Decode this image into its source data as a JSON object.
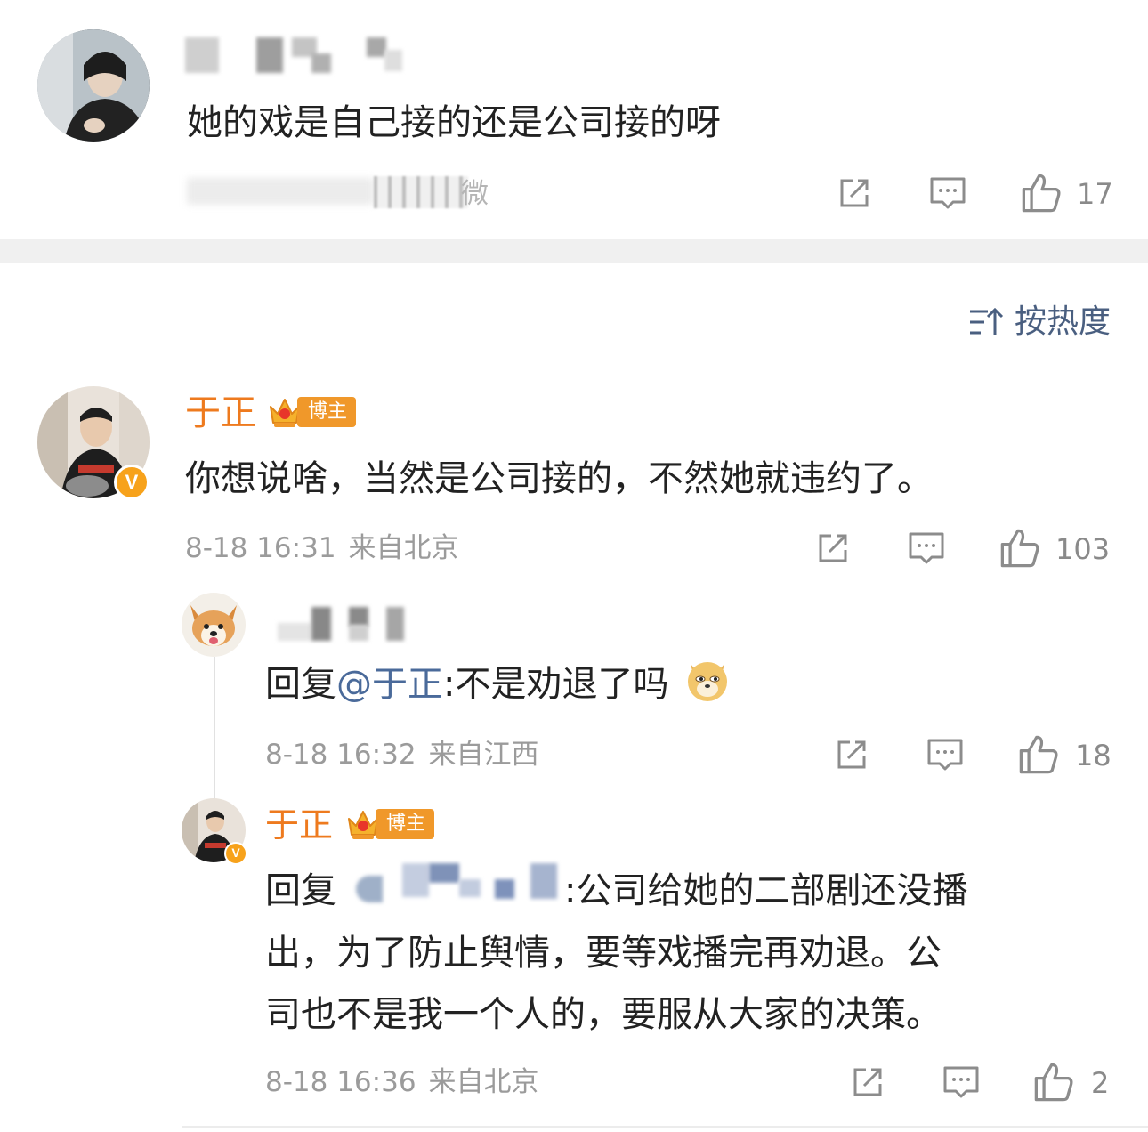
{
  "top_comment": {
    "text": "她的戏是自己接的还是公司接的呀",
    "meta_tail": "微",
    "likes": "17"
  },
  "sort": {
    "label": "按热度"
  },
  "main_comment": {
    "username": "于正",
    "badge": "博主",
    "verified_mark": "V",
    "text": "你想说啥，当然是公司接的，不然她就违约了。",
    "time": "8-18 16:31",
    "from": "来自北京",
    "likes": "103"
  },
  "reply_1": {
    "prefix": "回复",
    "mention": "@于正",
    "text": ":不是劝退了吗",
    "time": "8-18 16:32",
    "from": "来自江西",
    "likes": "18"
  },
  "reply_2": {
    "username": "于正",
    "badge": "博主",
    "verified_mark": "V",
    "prefix": "回复",
    "text_line1": ":公司给她的二部剧还没播",
    "text_line2": "出，为了防止舆情，要等戏播完再劝退。公",
    "text_line3": "司也不是我一个人的，要服从大家的决策。",
    "time": "8-18 16:36",
    "from": "来自北京",
    "likes": "2"
  },
  "icons": {
    "share": "share-icon",
    "comment": "comment-icon",
    "like": "thumbs-up-icon",
    "sort": "sort-icon",
    "crown": "crown-icon",
    "emoji": "doge-emoji-icon"
  },
  "colors": {
    "username": "#ee7a1e",
    "mention": "#4a6a9a",
    "meta": "#9b9b9b",
    "divider": "#f0f0f0",
    "badge": "#f0982a"
  }
}
